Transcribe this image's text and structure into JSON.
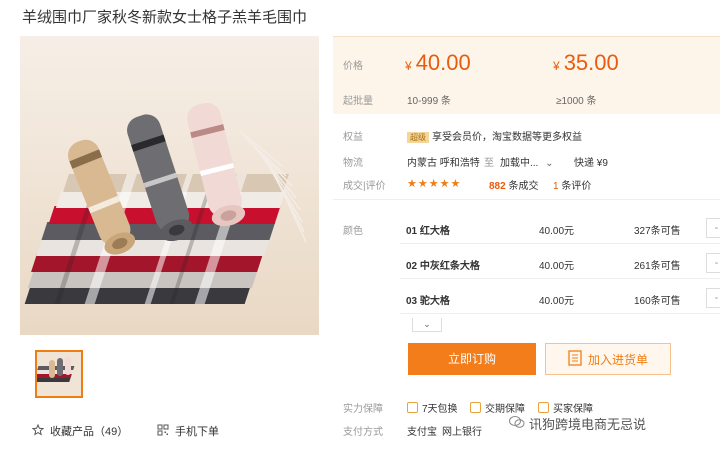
{
  "title": "羊绒围巾厂家秋冬新款女士格子羔羊毛围巾",
  "price": {
    "label_price": "价格",
    "label_batch": "起批量",
    "currency": "¥",
    "tier1_price": "40.00",
    "tier2_price": "35.00",
    "tier1_qty": "10-999 条",
    "tier2_qty": "≥1000 条"
  },
  "rights": {
    "label": "权益",
    "badge": "超级",
    "text": "享受会员价，淘宝数据等更多权益"
  },
  "shipping": {
    "label": "物流",
    "from": "内蒙古 呼和浩特",
    "to_icon": "至",
    "to": "加载中...",
    "express": "快递 ¥9"
  },
  "rating": {
    "label": "成交|评价",
    "stars": "★★★★★",
    "deals_count": "882",
    "deals_suffix": "条成交",
    "reviews_count": "1",
    "reviews_suffix": "条评价"
  },
  "colors": {
    "label": "颜色",
    "items": [
      {
        "name": "01 红大格",
        "price": "40.00元",
        "stock": "327条可售",
        "stepper": "-"
      },
      {
        "name": "02 中灰红条大格",
        "price": "40.00元",
        "stock": "261条可售",
        "stepper": "-"
      },
      {
        "name": "03 驼大格",
        "price": "40.00元",
        "stock": "160条可售",
        "stepper": "-"
      }
    ]
  },
  "buttons": {
    "order": "立即订购",
    "cart": "加入进货单"
  },
  "left_actions": {
    "favorite": "收藏产品（49）",
    "mobile": "手机下单"
  },
  "guarantee": {
    "label": "实力保障",
    "items": [
      "7天包换",
      "交期保障",
      "买家保障"
    ]
  },
  "payment": {
    "label": "支付方式",
    "items": [
      "支付宝",
      "网上银行"
    ]
  },
  "watermark": "讯狗跨境电商无忌说",
  "accent_color": "#f27d1a"
}
